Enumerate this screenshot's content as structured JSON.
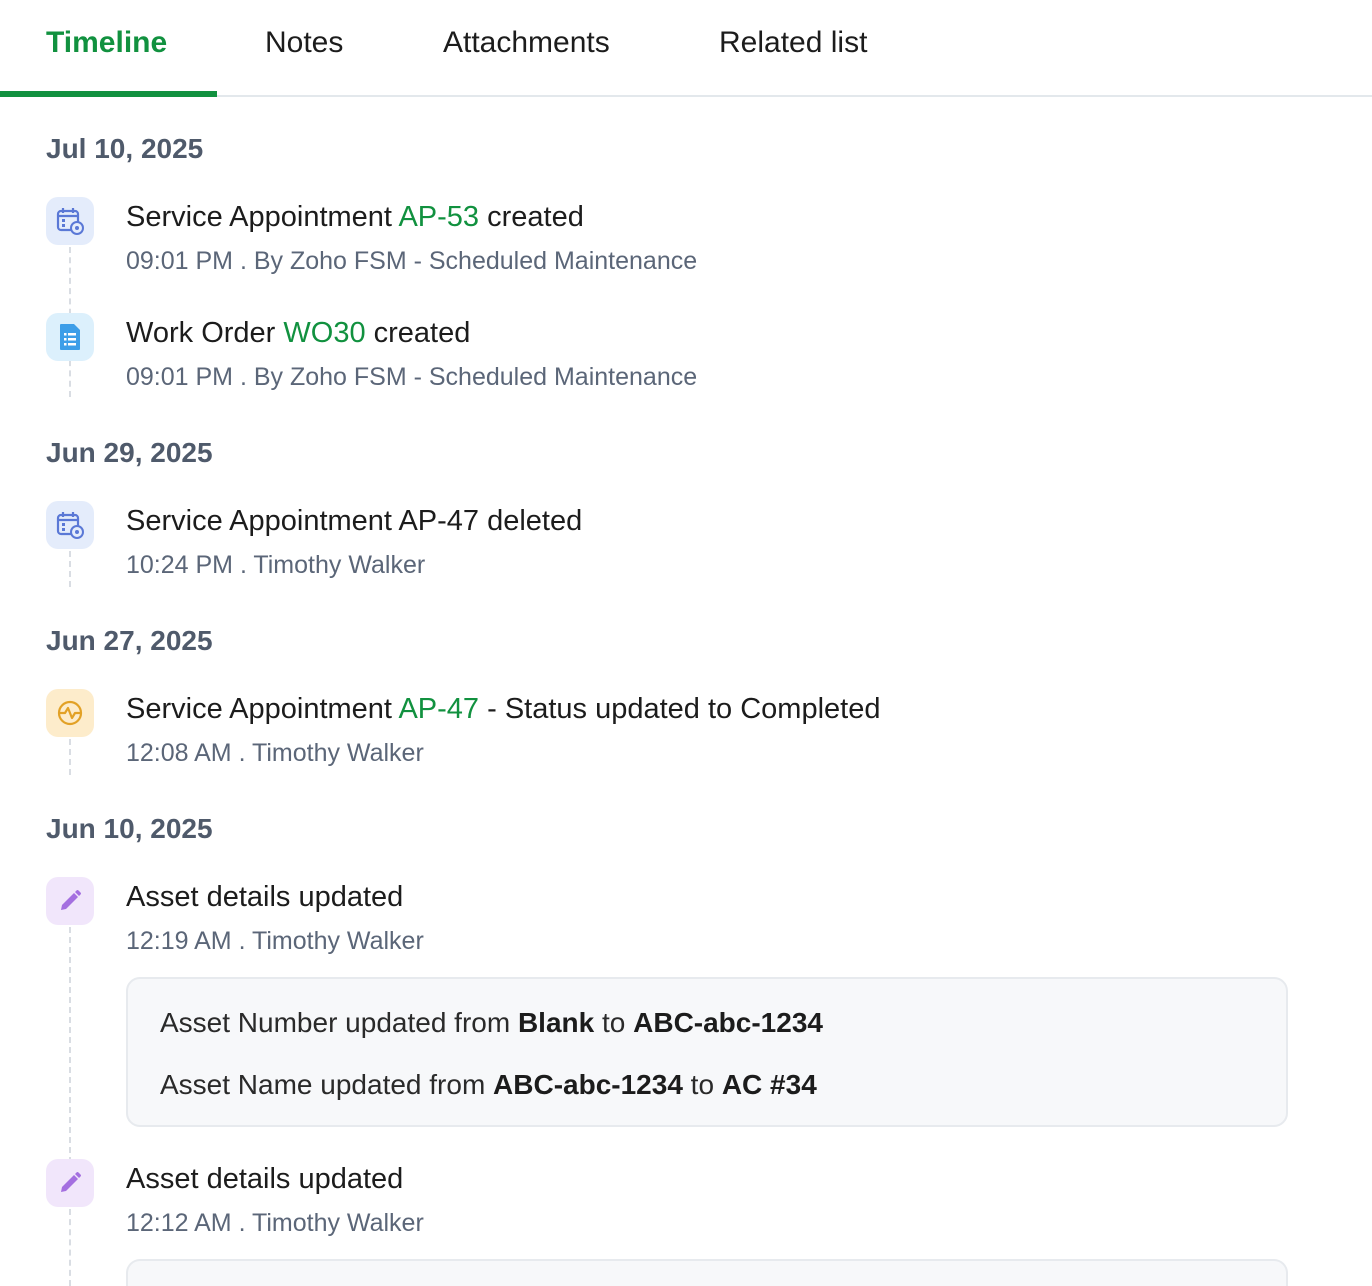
{
  "tabs": [
    {
      "label": "Timeline",
      "active": true
    },
    {
      "label": "Notes",
      "active": false
    },
    {
      "label": "Attachments",
      "active": false
    },
    {
      "label": "Related list",
      "active": false
    }
  ],
  "colors": {
    "accent": "#11913f",
    "muted_text": "#5b6678"
  },
  "timeline": {
    "groups": [
      {
        "date": "Jul 10, 2025",
        "entries": [
          {
            "icon": "service-appointment-icon",
            "title_prefix": "Service Appointment ",
            "title_link": "AP-53",
            "title_suffix": " created",
            "meta": "09:01 PM . By Zoho FSM - Scheduled Maintenance"
          },
          {
            "icon": "work-order-icon",
            "title_prefix": "Work Order ",
            "title_link": "WO30",
            "title_suffix": " created",
            "meta": "09:01 PM . By Zoho FSM - Scheduled Maintenance"
          }
        ]
      },
      {
        "date": "Jun 29, 2025",
        "entries": [
          {
            "icon": "service-appointment-icon",
            "title": "Service Appointment AP-47 deleted",
            "meta": "10:24 PM . Timothy Walker"
          }
        ]
      },
      {
        "date": "Jun 27, 2025",
        "entries": [
          {
            "icon": "status-update-icon",
            "title_prefix": "Service Appointment ",
            "title_link": "AP-47",
            "title_suffix": " - Status updated to Completed",
            "meta": "12:08 AM . Timothy Walker"
          }
        ]
      },
      {
        "date": "Jun 10, 2025",
        "entries": [
          {
            "icon": "edit-pencil-icon",
            "title": "Asset details updated",
            "meta": "12:19 AM . Timothy Walker",
            "details": [
              {
                "prefix": "Asset Number updated from ",
                "from": "Blank",
                "mid": " to ",
                "to": "ABC-abc-1234"
              },
              {
                "prefix": "Asset Name updated from ",
                "from": "ABC-abc-1234",
                "mid": " to ",
                "to": "AC #34"
              }
            ]
          },
          {
            "icon": "edit-pencil-icon",
            "title": "Asset details updated",
            "meta": "12:12 AM . Timothy Walker"
          }
        ]
      }
    ]
  }
}
